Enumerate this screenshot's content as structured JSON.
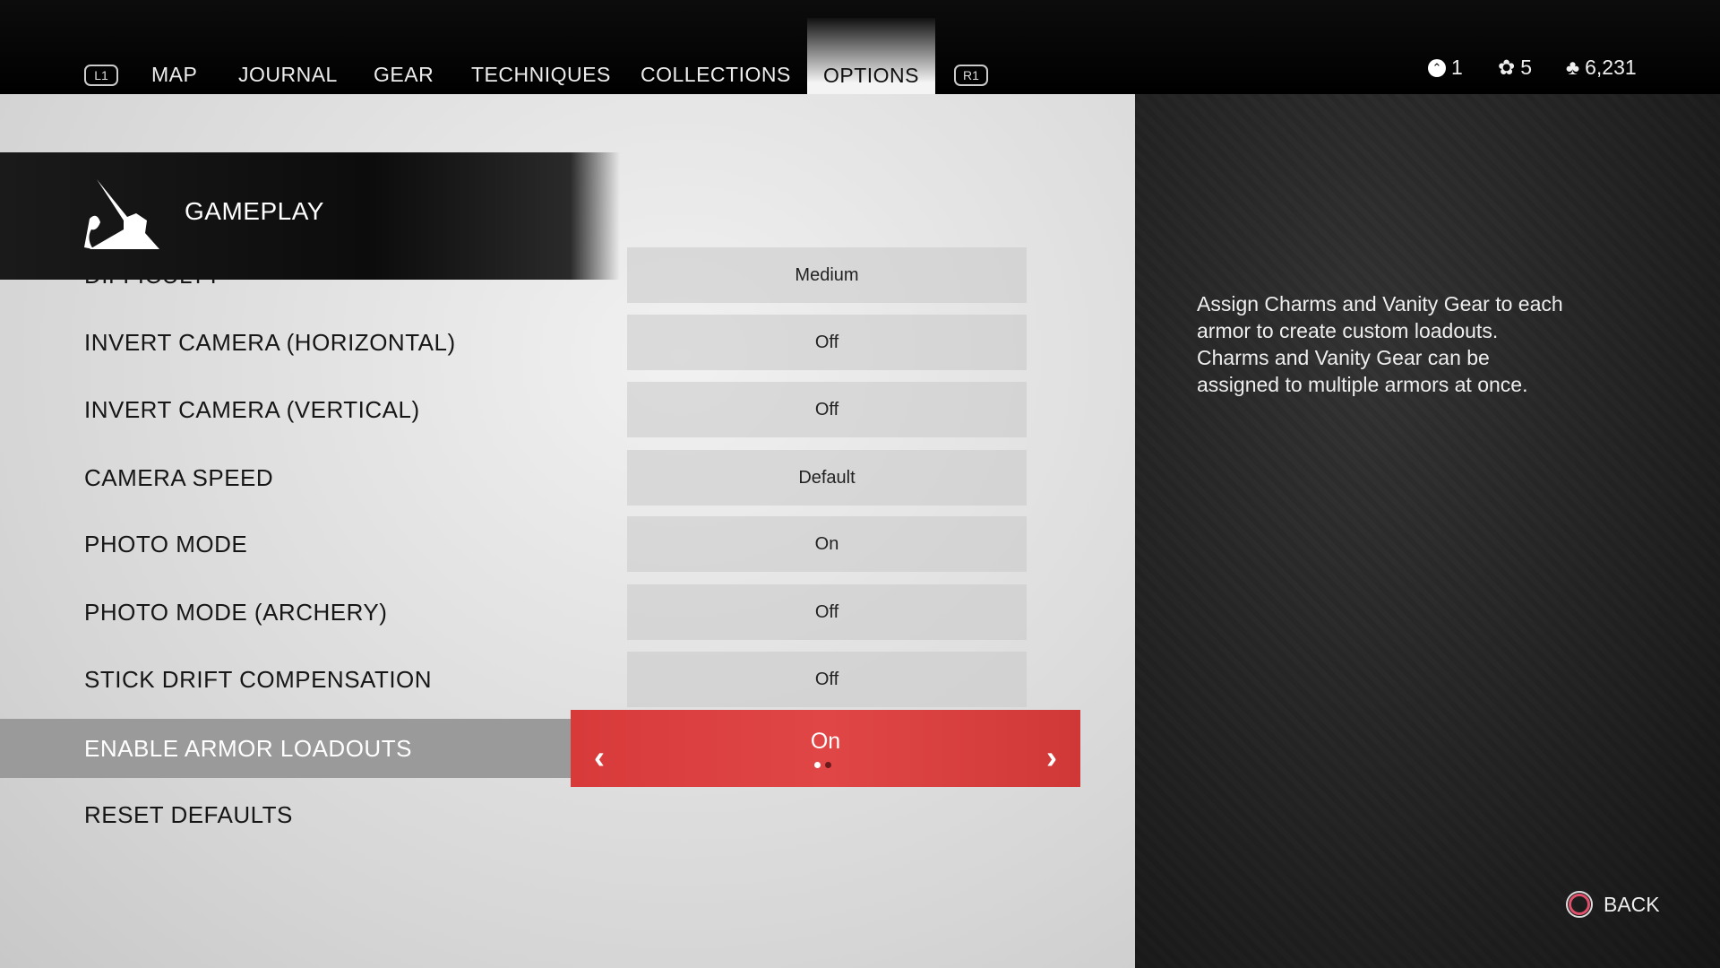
{
  "nav": {
    "left_button": "L1",
    "right_button": "R1",
    "tabs": [
      "MAP",
      "JOURNAL",
      "GEAR",
      "TECHNIQUES",
      "COLLECTIONS",
      "OPTIONS"
    ],
    "active": "OPTIONS"
  },
  "stats": {
    "level": "1",
    "flowers": "5",
    "supplies": "6,231"
  },
  "section": {
    "title": "GAMEPLAY",
    "icon": "samurai-icon"
  },
  "settings": [
    {
      "label": "DIFFICULTY",
      "value": "Medium"
    },
    {
      "label": "INVERT CAMERA (HORIZONTAL)",
      "value": "Off"
    },
    {
      "label": "INVERT CAMERA (VERTICAL)",
      "value": "Off"
    },
    {
      "label": "CAMERA SPEED",
      "value": "Default"
    },
    {
      "label": "PHOTO MODE",
      "value": "On"
    },
    {
      "label": "PHOTO MODE (ARCHERY)",
      "value": "Off"
    },
    {
      "label": "STICK DRIFT COMPENSATION",
      "value": "Off"
    },
    {
      "label": "ENABLE ARMOR LOADOUTS",
      "value": "On"
    },
    {
      "label": "RESET DEFAULTS"
    }
  ],
  "description": "Assign Charms and Vanity Gear to each armor to create custom loadouts. Charms and Vanity Gear can be assigned to multiple armors at once.",
  "back_label": "BACK",
  "colors": {
    "accent": "#d83a3a"
  }
}
